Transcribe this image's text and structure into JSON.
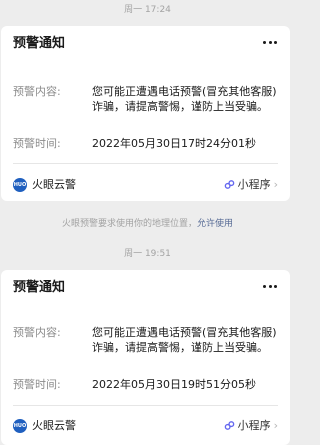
{
  "messages": [
    {
      "time": "周一 17:24",
      "title": "预警通知",
      "content_label": "预警内容:",
      "content_value": "您可能正遭遇电话预警(冒充其他客服)诈骗，请提高警惕，谨防上当受骗。",
      "time_label": "预警时间:",
      "time_value": "2022年05月30日17时24分01秒",
      "app_logo_text": "HUO",
      "app_name": "火眼云警",
      "mini_program": "小程序"
    },
    {
      "time": "周一 19:51",
      "title": "预警通知",
      "content_label": "预警内容:",
      "content_value": "您可能正遭遇电话预警(冒充其他客服)诈骗，请提高警惕，谨防上当受骗。",
      "time_label": "预警时间:",
      "time_value": "2022年05月30日19时51分05秒",
      "app_logo_text": "HUO",
      "app_name": "火眼云警",
      "mini_program": "小程序"
    }
  ],
  "location_notice": {
    "text": "火眼预警要求使用你的地理位置，",
    "allow_label": "允许使用"
  },
  "icons": {
    "more": "more-dots-icon",
    "mini_program": "mini-program-icon",
    "chevron": "chevron-right-icon"
  },
  "colors": {
    "background": "#ededed",
    "card": "#ffffff",
    "link": "#576b95",
    "logo": "#1f5fbf",
    "mini_program_icon": "#6467f0"
  }
}
